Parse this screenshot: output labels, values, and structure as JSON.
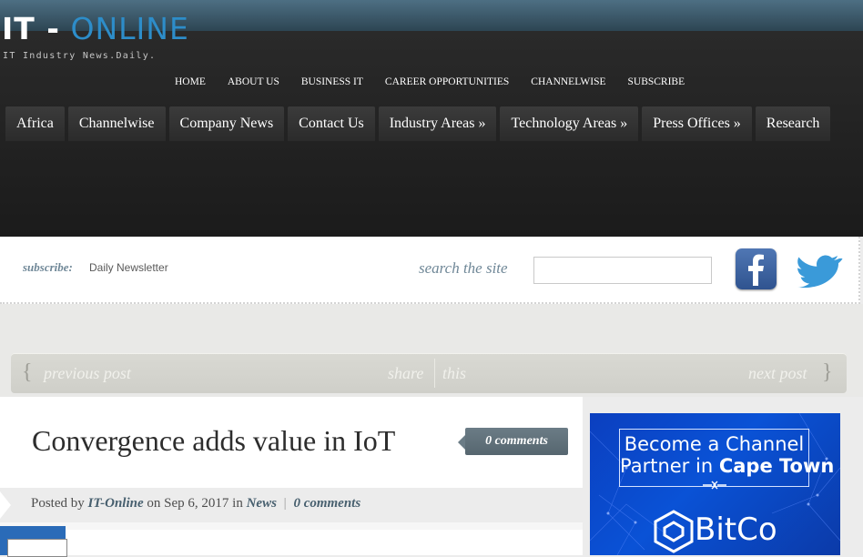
{
  "header": {
    "logo_part1": "IT -",
    "logo_part2": "ONLINE",
    "tagline": "IT Industry News.Daily.",
    "top_nav": [
      "HOME",
      "ABOUT US",
      "BUSINESS IT",
      "CAREER OPPORTUNITIES",
      "CHANNELWISE",
      "SUBSCRIBE"
    ],
    "categories": [
      "Africa",
      "Channelwise",
      "Company News",
      "Contact Us",
      "Industry Areas »",
      "Technology Areas »",
      "Press Offices »",
      "Research"
    ]
  },
  "toolbar": {
    "subscribe_label": "subscribe:",
    "subscribe_link": "Daily Newsletter",
    "search_label": "search the site",
    "search_value": "",
    "social_icons": [
      "facebook-icon",
      "twitter-icon"
    ]
  },
  "post_nav": {
    "previous": "previous post",
    "share": "share",
    "share_this": "this",
    "next": "next post",
    "brace_open": "{",
    "brace_close": "}"
  },
  "article": {
    "title": "Convergence adds value in IoT",
    "comments_badge": "0 comments",
    "meta_posted_by": "Posted by",
    "meta_author": "IT-Online",
    "meta_on": "on Sep 6, 2017 in",
    "meta_category": "News",
    "meta_sep": "|",
    "meta_comments": "0 comments"
  },
  "ad": {
    "line1": "Become a Channel",
    "line2_prefix": "Partner in",
    "line2_bold": "Cape Town",
    "brand": "BitCo"
  },
  "colors": {
    "accent_blue": "#2d8dc9",
    "link_slate": "#48606f",
    "ad_blue": "#0a52d6"
  }
}
